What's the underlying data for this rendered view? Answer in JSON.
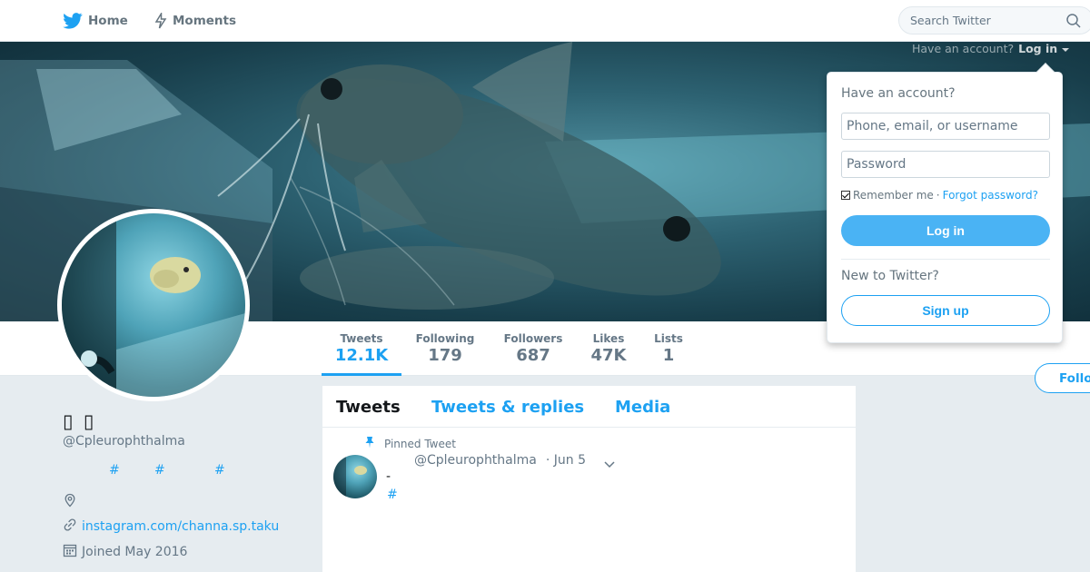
{
  "nav": {
    "home_label": "Home",
    "moments_label": "Moments",
    "search_placeholder": "Search Twitter"
  },
  "login_hint": {
    "text": "Have an account?",
    "button": "Log in"
  },
  "profile": {
    "name": "▯ ▯",
    "handle": "@Cpleurophthalma",
    "bio_hashtags": [
      "#",
      "#",
      "#"
    ],
    "location": "",
    "website": "instagram.com/channa.sp.taku",
    "joined": "Joined May 2016",
    "follow_label": "Follow"
  },
  "stats": [
    {
      "label": "Tweets",
      "value": "12.1K"
    },
    {
      "label": "Following",
      "value": "179"
    },
    {
      "label": "Followers",
      "value": "687"
    },
    {
      "label": "Likes",
      "value": "47K"
    },
    {
      "label": "Lists",
      "value": "1"
    }
  ],
  "timeline": {
    "tabs": [
      "Tweets",
      "Tweets & replies",
      "Media"
    ],
    "pinned_label": "Pinned Tweet",
    "tweet": {
      "handle": "@Cpleurophthalma",
      "date": "· Jun 5",
      "text": "-",
      "hashtag": "#"
    }
  },
  "login_panel": {
    "title": "Have an account?",
    "username_placeholder": "Phone, email, or username",
    "password_placeholder": "Password",
    "remember_label": "Remember me",
    "separator": "·",
    "forgot_label": "Forgot password?",
    "login_button": "Log in",
    "new_label": "New to Twitter?",
    "signup_button": "Sign up"
  },
  "colors": {
    "accent": "#1da1f2",
    "login_button": "#4ab3f4",
    "page_background": "#e6ecf0"
  }
}
